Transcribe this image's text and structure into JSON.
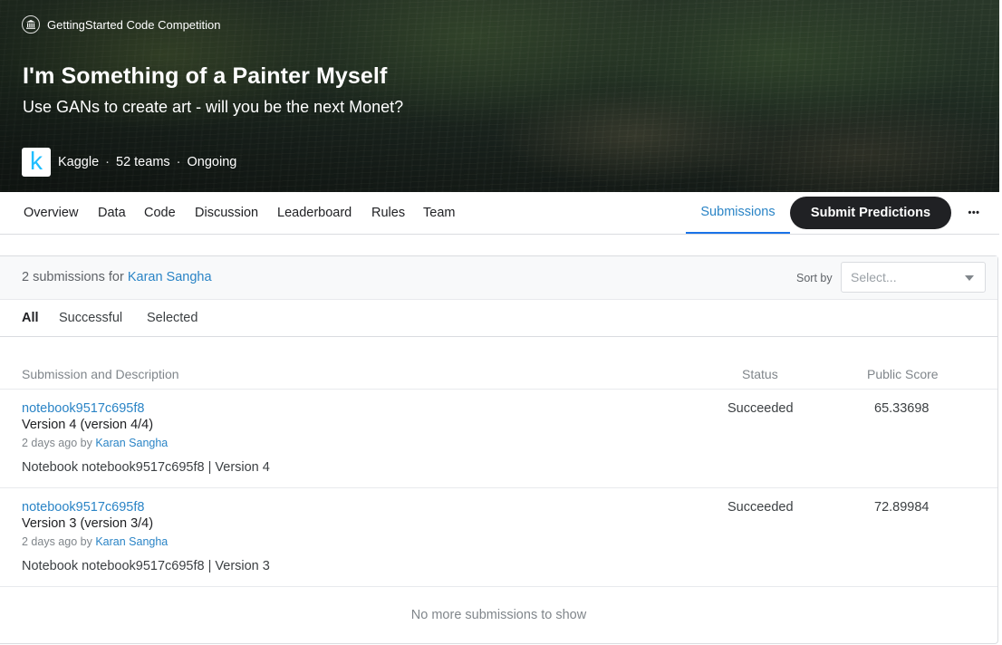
{
  "hero": {
    "type_label": "GettingStarted Code Competition",
    "title": "I'm Something of a Painter Myself",
    "subtitle": "Use GANs to create art - will you be the next Monet?",
    "host": "Kaggle",
    "host_logo_letter": "k",
    "teams": "52 teams",
    "state": "Ongoing",
    "separator": "·"
  },
  "tabs": {
    "items": [
      "Overview",
      "Data",
      "Code",
      "Discussion",
      "Leaderboard",
      "Rules",
      "Team"
    ],
    "active": "Submissions",
    "submit_label": "Submit Predictions",
    "more_label": "•••"
  },
  "submissions": {
    "count_text": "2 submissions for",
    "user": "Karan Sangha",
    "sort_label": "Sort by",
    "sort_placeholder": "Select...",
    "filters": [
      "All",
      "Successful",
      "Selected"
    ],
    "columns": {
      "description": "Submission and Description",
      "status": "Status",
      "score": "Public Score"
    },
    "rows": [
      {
        "notebook": "notebook9517c695f8",
        "version": "Version 4 (version 4/4)",
        "time": "2 days ago by",
        "by": "Karan Sangha",
        "description": "Notebook notebook9517c695f8 | Version 4",
        "status": "Succeeded",
        "score": "65.33698"
      },
      {
        "notebook": "notebook9517c695f8",
        "version": "Version 3 (version 3/4)",
        "time": "2 days ago by",
        "by": "Karan Sangha",
        "description": "Notebook notebook9517c695f8 | Version 3",
        "status": "Succeeded",
        "score": "72.89984"
      }
    ],
    "footer": "No more submissions to show"
  },
  "colors": {
    "accent": "#2a84c6",
    "submit_button": "#202124",
    "kaggle_blue": "#20beff"
  },
  "icons": {
    "competition_type": "institution-icon",
    "more": "more-horizontal-icon",
    "sort_caret": "chevron-down-icon"
  }
}
